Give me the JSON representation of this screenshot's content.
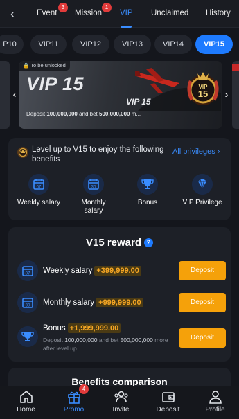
{
  "topbar": {
    "tabs": [
      {
        "label": "Event",
        "badge": "3"
      },
      {
        "label": "Mission",
        "badge": "1"
      },
      {
        "label": "VIP",
        "active": true
      },
      {
        "label": "Unclaimed"
      },
      {
        "label": "History"
      }
    ]
  },
  "levels": [
    "P10",
    "VIP11",
    "VIP12",
    "VIP13",
    "VIP14",
    "VIP15"
  ],
  "selected_level": "VIP15",
  "hero": {
    "tag": "To be unlocked",
    "title": "VIP 15",
    "subtitle": "VIP 15",
    "badge_text": "VIP 15",
    "desc_prefix": "Deposit ",
    "desc_deposit": "100,000,000",
    "desc_mid": " and bet ",
    "desc_bet": "500,000,000",
    "desc_suffix": " m..."
  },
  "privileges": {
    "title": "Level up to V15 to enjoy the following benefits",
    "link": "All privileges",
    "items": [
      {
        "label": "Weekly salary",
        "icon": "calendar-icon",
        "icon_text": "07"
      },
      {
        "label": "Monthly salary",
        "icon": "calendar-icon",
        "icon_text": "30"
      },
      {
        "label": "Bonus",
        "icon": "trophy-icon"
      },
      {
        "label": "VIP Privilege",
        "icon": "diamond-icon"
      }
    ]
  },
  "reward": {
    "title": "V15 reward",
    "rows": [
      {
        "label": "Weekly salary",
        "amount": "+399,999.00",
        "button": "Deposit",
        "icon_text": "07"
      },
      {
        "label": "Monthly salary",
        "amount": "+999,999.00",
        "button": "Deposit",
        "icon_text": "30"
      },
      {
        "label": "Bonus",
        "amount": "+1,999,999.00",
        "button": "Deposit"
      }
    ],
    "bonus_desc": {
      "p1": "Deposit ",
      "deposit": "100,000,000",
      "p2": " and bet ",
      "bet": "500,000,000",
      "p3": " more after level up"
    }
  },
  "benefits": {
    "title": "Benefits comparison"
  },
  "bottomnav": {
    "items": [
      {
        "label": "Home",
        "icon": "home-icon"
      },
      {
        "label": "Promo",
        "icon": "gift-icon",
        "badge": "4",
        "active": true
      },
      {
        "label": "Invite",
        "icon": "invite-icon"
      },
      {
        "label": "Deposit",
        "icon": "wallet-icon"
      },
      {
        "label": "Profile",
        "icon": "profile-icon"
      }
    ]
  },
  "colors": {
    "accent": "#1e7bff",
    "gold": "#f5a623",
    "deposit_button": "#f5a10a",
    "badge": "#e23b3b"
  }
}
